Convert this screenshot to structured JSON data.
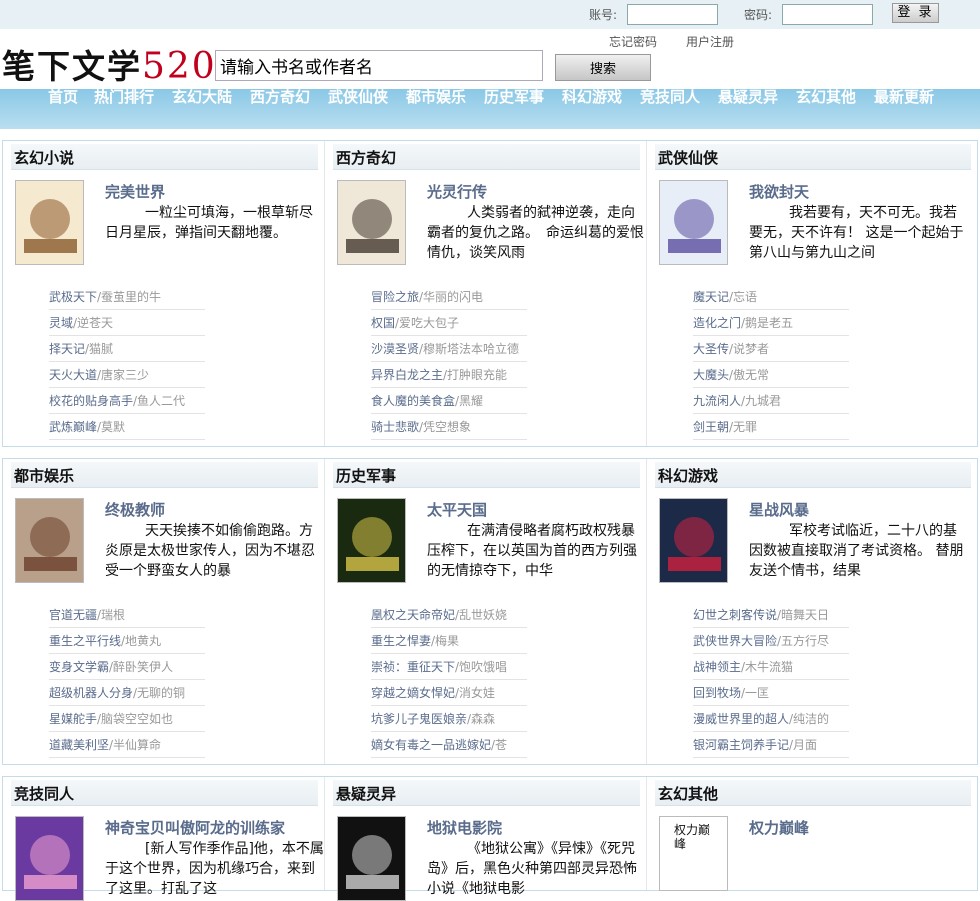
{
  "topbar": {
    "account_label": "账号:",
    "password_label": "密码:",
    "login_button": "登 录",
    "forgot_link": "忘记密码",
    "register_link": "用户注册"
  },
  "logo": {
    "text": "笔下文学",
    "number": "520"
  },
  "search": {
    "value": "请输入书名或作者名",
    "button": "搜索"
  },
  "nav": [
    "首页",
    "热门排行",
    "玄幻大陆",
    "西方奇幻",
    "武侠仙侠",
    "都市娱乐",
    "历史军事",
    "科幻游戏",
    "竞技同人",
    "悬疑灵异",
    "玄幻其他",
    "最新更新"
  ],
  "sections": [
    [
      {
        "name": "玄幻小说",
        "book": {
          "title": "完美世界",
          "desc": "一粒尘可填海，一根草斩尽日月星辰，弹指间天翻地覆。"
        },
        "list": [
          [
            "武极天下",
            "蚕茧里的牛"
          ],
          [
            "灵域",
            "逆苍天"
          ],
          [
            "择天记",
            "猫腻"
          ],
          [
            "天火大道",
            "唐家三少"
          ],
          [
            "校花的贴身高手",
            "鱼人二代"
          ],
          [
            "武炼巅峰",
            "莫默"
          ]
        ]
      },
      {
        "name": "西方奇幻",
        "book": {
          "title": "光灵行传",
          "desc": "人类弱者的弑神逆袭，走向霸者的复仇之路。　命运纠葛的爱恨情仇，谈笑风雨"
        },
        "list": [
          [
            "冒险之旅",
            "华丽的闪电"
          ],
          [
            "权国",
            "爱吃大包子"
          ],
          [
            "沙漠圣贤",
            "穆斯塔法本哈立德"
          ],
          [
            "异界白龙之主",
            "打肿眼充能"
          ],
          [
            "食人魔的美食盒",
            "黑耀"
          ],
          [
            "骑士悲歌",
            "凭空想象"
          ]
        ]
      },
      {
        "name": "武侠仙侠",
        "book": {
          "title": "我欲封天",
          "desc": "我若要有，天不可无。我若要无，天不许有！ 这是一个起始于第八山与第九山之间"
        },
        "list": [
          [
            "魔天记",
            "忘语"
          ],
          [
            "造化之门",
            "鹅是老五"
          ],
          [
            "大圣传",
            "说梦者"
          ],
          [
            "大魔头",
            "傲无常"
          ],
          [
            "九流闲人",
            "九城君"
          ],
          [
            "剑王朝",
            "无罪"
          ]
        ]
      }
    ],
    [
      {
        "name": "都市娱乐",
        "book": {
          "title": "终极教师",
          "desc": "天天挨揍不如偷偷跑路。方炎原是太极世家传人，因为不堪忍受一个野蛮女人的暴"
        },
        "list": [
          [
            "官道无疆",
            "瑞根"
          ],
          [
            "重生之平行线",
            "地黄丸"
          ],
          [
            "变身文学霸",
            "醉卧笑伊人"
          ],
          [
            "超级机器人分身",
            "无聊的铜"
          ],
          [
            "星媒舵手",
            "脑袋空空如也"
          ],
          [
            "道藏美利坚",
            "半仙算命"
          ]
        ]
      },
      {
        "name": "历史军事",
        "book": {
          "title": "太平天国",
          "desc": "在满清侵略者腐朽政权残暴压榨下，在以英国为首的西方列强的无情掠夺下，中华"
        },
        "list": [
          [
            "凰权之天命帝妃",
            "乱世妖娆"
          ],
          [
            "重生之悍妻",
            "梅果"
          ],
          [
            "崇祯：重征天下",
            "饱吹饿唱"
          ],
          [
            "穿越之嫡女悍妃",
            "消女娃"
          ],
          [
            "坑爹儿子鬼医娘亲",
            "森森"
          ],
          [
            "嫡女有毒之一品逃嫁妃",
            "苍"
          ]
        ]
      },
      {
        "name": "科幻游戏",
        "book": {
          "title": "星战风暴",
          "desc": "军校考试临近，二十八的基因数被直接取消了考试资格。 替朋友送个情书，结果"
        },
        "list": [
          [
            "幻世之刺客传说",
            "暗舞天日"
          ],
          [
            "武侠世界大冒险",
            "五方行尽"
          ],
          [
            "战神领主",
            "木牛流猫"
          ],
          [
            "回到牧场",
            "一匡"
          ],
          [
            "漫威世界里的超人",
            "纯洁的"
          ],
          [
            "银河霸主饲养手记",
            "月面"
          ]
        ]
      }
    ],
    [
      {
        "name": "竞技同人",
        "book": {
          "title": "神奇宝贝叫傲阿龙的训练家",
          "desc": "[新人写作季作品]他，本不属于这个世界，因为机缘巧合，来到了这里。打乱了这"
        },
        "list": []
      },
      {
        "name": "悬疑灵异",
        "book": {
          "title": "地狱电影院",
          "desc": "《地狱公寓》《异悚》《死咒岛》后，黑色火种第四部灵异恐怖小说《地狱电影"
        },
        "list": []
      },
      {
        "name": "玄幻其他",
        "book": {
          "title": "权力巅峰",
          "desc": "",
          "cover_text": "权力巅峰"
        },
        "list": []
      }
    ]
  ],
  "colors": {
    "nav": "#8ac8e6",
    "title": "#5a6c8c",
    "logo_num": "#c0001c"
  }
}
